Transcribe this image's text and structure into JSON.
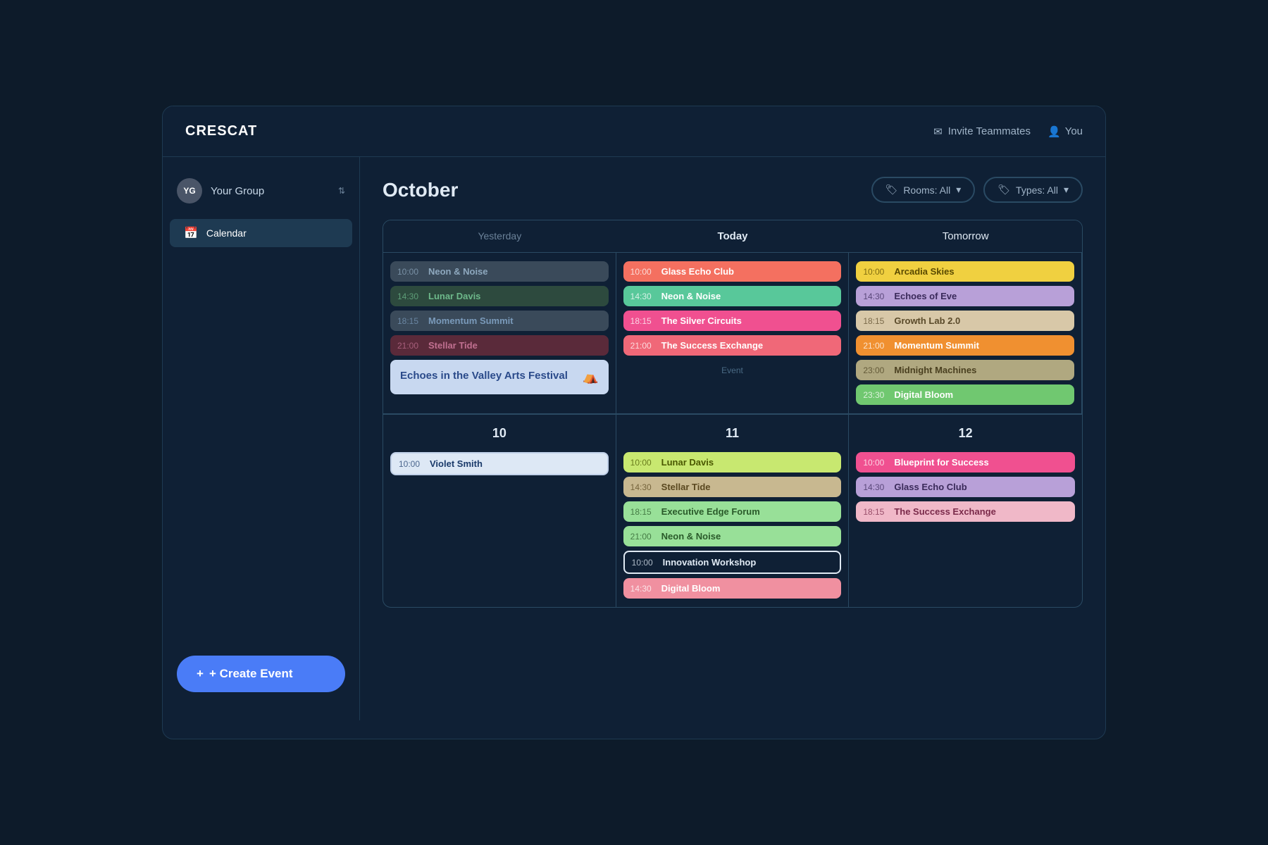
{
  "app": {
    "logo": "CRESCAT",
    "header": {
      "invite_label": "Invite Teammates",
      "user_label": "You"
    }
  },
  "sidebar": {
    "group_initials": "YG",
    "group_name": "Your Group",
    "nav_items": [
      {
        "label": "Calendar",
        "icon": "📅",
        "active": true
      }
    ],
    "create_event_label": "+ Create Event"
  },
  "calendar": {
    "month": "October",
    "filters": {
      "rooms_label": "Rooms: All",
      "types_label": "Types: All"
    },
    "columns": [
      {
        "header": "Yesterday",
        "type": "yesterday",
        "events": [
          {
            "time": "10:00",
            "name": "Neon & Noise",
            "color": "ev-gray"
          },
          {
            "time": "14:30",
            "name": "Lunar Davis",
            "color": "ev-dark-green"
          },
          {
            "time": "18:15",
            "name": "Momentum Summit",
            "color": "ev-dark-pink"
          },
          {
            "time": "21:00",
            "name": "Stellar Tide",
            "color": "ev-dark-pink"
          }
        ],
        "festival": {
          "name": "Echoes in the Valley Arts Festival",
          "icon": "⛺"
        }
      },
      {
        "header": "Today",
        "type": "today",
        "events": [
          {
            "time": "10:00",
            "name": "Glass Echo Club",
            "color": "ev-coral"
          },
          {
            "time": "14:30",
            "name": "Neon & Noise",
            "color": "ev-mint"
          },
          {
            "time": "18:15",
            "name": "The Silver Circuits",
            "color": "ev-hot-pink"
          },
          {
            "time": "21:00",
            "name": "The Success Exchange",
            "color": "ev-pink-red"
          }
        ],
        "bottom_label": "Event"
      },
      {
        "header": "Tomorrow",
        "type": "tomorrow",
        "events": [
          {
            "time": "10:00",
            "name": "Arcadia Skies",
            "color": "ev-yellow"
          },
          {
            "time": "14:30",
            "name": "Echoes of Eve",
            "color": "ev-lavender"
          },
          {
            "time": "18:15",
            "name": "Growth Lab 2.0",
            "color": "ev-beige"
          },
          {
            "time": "21:00",
            "name": "Momentum Summit",
            "color": "ev-orange"
          },
          {
            "time": "23:00",
            "name": "Midnight Machines",
            "color": "ev-dark-beige"
          },
          {
            "time": "23:30",
            "name": "Digital Bloom",
            "color": "ev-green"
          }
        ]
      }
    ],
    "date_rows": [
      {
        "date": "10",
        "events": [
          {
            "time": "10:00",
            "name": "Violet Smith",
            "color": "ev-white-bg"
          }
        ]
      },
      {
        "date": "11",
        "events": [
          {
            "time": "10:00",
            "name": "Lunar Davis",
            "color": "ev-lime"
          },
          {
            "time": "14:30",
            "name": "Stellar Tide",
            "color": "ev-tan"
          },
          {
            "time": "18:15",
            "name": "Executive Edge Forum",
            "color": "ev-light-green"
          },
          {
            "time": "21:00",
            "name": "Neon & Noise",
            "color": "ev-light-green"
          },
          {
            "time": "10:00",
            "name": "Innovation Workshop",
            "color": "ev-white-outline"
          },
          {
            "time": "14:30",
            "name": "Digital Bloom",
            "color": "ev-rose"
          }
        ]
      },
      {
        "date": "12",
        "events": [
          {
            "time": "10:00",
            "name": "Blueprint for Success",
            "color": "ev-hot-pink"
          },
          {
            "time": "14:30",
            "name": "Glass Echo Club",
            "color": "ev-lavender"
          },
          {
            "time": "18:15",
            "name": "The Success Exchange",
            "color": "ev-pink-light"
          }
        ]
      }
    ]
  }
}
